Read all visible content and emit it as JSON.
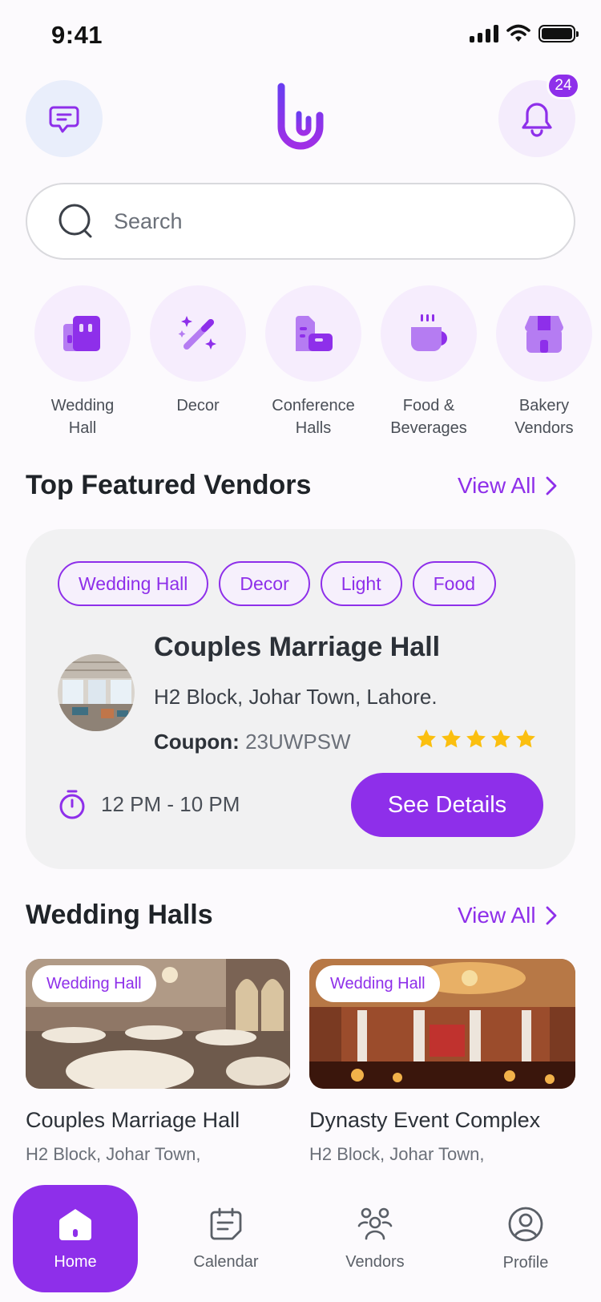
{
  "status_bar": {
    "time": "9:41"
  },
  "header": {
    "notification_count": "24"
  },
  "search": {
    "placeholder": "Search"
  },
  "categories": [
    {
      "label": "Wedding\nHall",
      "icon": "building-icon"
    },
    {
      "label": "Decor",
      "icon": "magic-wand-icon"
    },
    {
      "label": "Conference\nHalls",
      "icon": "conference-icon"
    },
    {
      "label": "Food &\nBeverages",
      "icon": "coffee-cup-icon"
    },
    {
      "label": "Bakery\nVendors",
      "icon": "store-icon"
    }
  ],
  "featured": {
    "title": "Top Featured Vendors",
    "view_all": "View All",
    "tags": [
      "Wedding Hall",
      "Decor",
      "Light",
      "Food"
    ],
    "name": "Couples Marriage Hall",
    "address": "H2 Block, Johar Town, Lahore.",
    "coupon_label": "Coupon:",
    "coupon_code": "23UWPSW",
    "rating": 5,
    "hours": "12 PM - 10 PM",
    "details_button": "See Details"
  },
  "wedding_halls": {
    "title": "Wedding Halls",
    "view_all": "View All",
    "items": [
      {
        "tag": "Wedding Hall",
        "name": "Couples Marriage Hall",
        "address": "H2 Block, Johar Town,"
      },
      {
        "tag": "Wedding Hall",
        "name": "Dynasty Event Complex",
        "address": "H2 Block, Johar Town,"
      }
    ]
  },
  "nav": {
    "items": [
      {
        "label": "Home",
        "icon": "home-icon"
      },
      {
        "label": "Calendar",
        "icon": "calendar-icon"
      },
      {
        "label": "Vendors",
        "icon": "vendors-icon"
      },
      {
        "label": "Profile",
        "icon": "profile-icon"
      }
    ]
  },
  "colors": {
    "accent": "#8E2FEA",
    "accent_light": "#F6EDFD",
    "star": "#FBBF0F"
  }
}
